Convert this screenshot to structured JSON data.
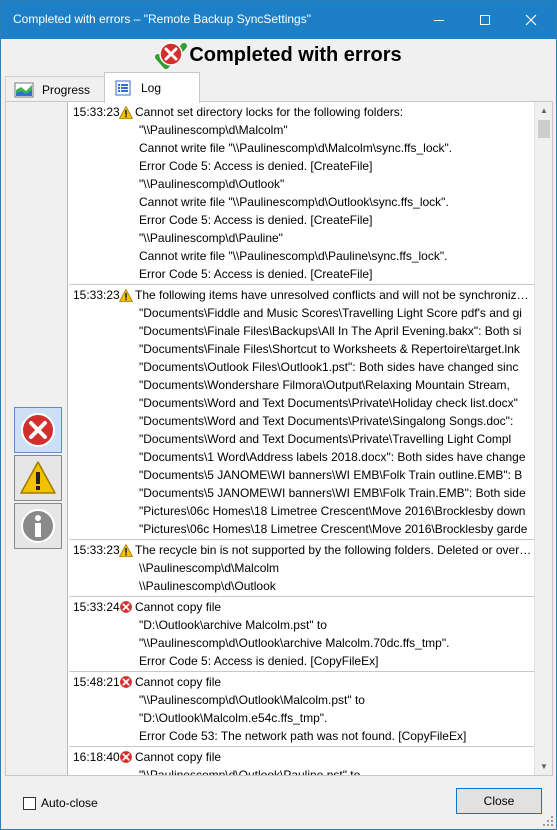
{
  "window": {
    "title": "Completed with errors – \"Remote Backup SyncSettings\"",
    "minimize": "minimize",
    "maximize": "maximize",
    "close": "close"
  },
  "header": {
    "title": "Completed with errors",
    "icon": "error-overlay-icon"
  },
  "tabs": [
    {
      "label": "Progress",
      "icon": "progress-chart-icon",
      "active": false
    },
    {
      "label": "Log",
      "icon": "log-list-icon",
      "active": true
    }
  ],
  "filters": [
    {
      "name": "errors",
      "icon": "error-icon",
      "selected": true
    },
    {
      "name": "warnings",
      "icon": "warning-icon",
      "selected": true
    },
    {
      "name": "info",
      "icon": "info-icon",
      "selected": false
    }
  ],
  "log": [
    {
      "time": "15:33:23",
      "level": "warning",
      "lines": [
        "Cannot set directory locks for the following folders:",
        "\"\\\\Paulinescomp\\d\\Malcolm\"",
        "Cannot write file \"\\\\Paulinescomp\\d\\Malcolm\\sync.ffs_lock\".",
        "Error Code 5: Access is denied. [CreateFile]",
        "\"\\\\Paulinescomp\\d\\Outlook\"",
        "Cannot write file \"\\\\Paulinescomp\\d\\Outlook\\sync.ffs_lock\".",
        "Error Code 5: Access is denied. [CreateFile]",
        "\"\\\\Paulinescomp\\d\\Pauline\"",
        "Cannot write file \"\\\\Paulinescomp\\d\\Pauline\\sync.ffs_lock\".",
        "Error Code 5: Access is denied. [CreateFile]"
      ]
    },
    {
      "time": "15:33:23",
      "level": "warning",
      "lines": [
        "The following items have unresolved conflicts and will not be synchronized:",
        "\"Documents\\Fiddle and Music Scores\\Travelling Light Score pdf's and gi",
        "\"Documents\\Finale Files\\Backups\\All In The April Evening.bakx\": Both si",
        "\"Documents\\Finale Files\\Shortcut to Worksheets & Repertoire\\target.lnk",
        "\"Documents\\Outlook Files\\Outlook1.pst\": Both sides have changed sinc",
        "\"Documents\\Wondershare Filmora\\Output\\Relaxing Mountain Stream,",
        "\"Documents\\Word and Text Documents\\Private\\Holiday check list.docx\"",
        "\"Documents\\Word and Text Documents\\Private\\Singalong Songs.doc\":",
        "\"Documents\\Word and Text Documents\\Private\\Travelling Light Compl",
        "\"Documents\\1 Word\\Address labels 2018.docx\": Both sides have change",
        "\"Documents\\5 JANOME\\WI banners\\WI EMB\\Folk Train outline.EMB\": B",
        "\"Documents\\5 JANOME\\WI banners\\WI EMB\\Folk Train.EMB\": Both side",
        "\"Pictures\\06c Homes\\18 Limetree Crescent\\Move 2016\\Brocklesby down",
        "\"Pictures\\06c Homes\\18 Limetree Crescent\\Move 2016\\Brocklesby garde"
      ]
    },
    {
      "time": "15:33:23",
      "level": "warning",
      "lines": [
        "The recycle bin is not supported by the following folders. Deleted or overwritten",
        "\\\\Paulinescomp\\d\\Malcolm",
        "\\\\Paulinescomp\\d\\Outlook"
      ]
    },
    {
      "time": "15:33:24",
      "level": "error",
      "lines": [
        "Cannot copy file",
        "\"D:\\Outlook\\archive Malcolm.pst\" to",
        "\"\\\\Paulinescomp\\d\\Outlook\\archive Malcolm.70dc.ffs_tmp\".",
        "Error Code 5: Access is denied. [CopyFileEx]"
      ]
    },
    {
      "time": "15:48:21",
      "level": "error",
      "lines": [
        "Cannot copy file",
        "\"\\\\Paulinescomp\\d\\Outlook\\Malcolm.pst\" to",
        "\"D:\\Outlook\\Malcolm.e54c.ffs_tmp\".",
        "Error Code 53: The network path was not found. [CopyFileEx]"
      ]
    },
    {
      "time": "16:18:40",
      "level": "error",
      "lines": [
        "Cannot copy file",
        "\"\\\\Paulinescomp\\d\\Outlook\\Pauline.pst\" to"
      ]
    }
  ],
  "footer": {
    "autoclose_label": "Auto-close",
    "autoclose_checked": false,
    "close_label": "Close"
  },
  "colors": {
    "titlebar": "#1d7fc6",
    "error": "#d32f2f",
    "warning": "#f2c200",
    "accent": "#0078d7"
  }
}
